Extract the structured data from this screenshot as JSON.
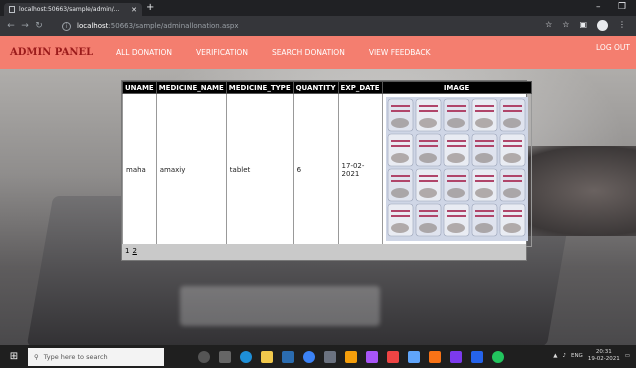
{
  "browser": {
    "tab_title": "localhost:50663/sample/admin/...",
    "new_tab": "+",
    "url_host": "localhost",
    "url_path": ":50663/sample/adminallonation.aspx",
    "minimize": "–",
    "restore": "❐",
    "close": "✕"
  },
  "nav": {
    "brand": "ADMIN PANEL",
    "links": [
      "ALL DONATION",
      "VERIFICATION",
      "SEARCH DONATION",
      "VIEW FEEDBACK"
    ],
    "logout": "LOG OUT"
  },
  "grid": {
    "headers": [
      "UNAME",
      "MEDICINE_NAME",
      "MEDICINE_TYPE",
      "QUANTITY",
      "EXP_DATE",
      "IMAGE"
    ],
    "rows": [
      {
        "uname": "maha",
        "medicine_name": "amaxiy",
        "medicine_type": "tablet",
        "quantity": "6",
        "exp_date": "17-02-2021"
      }
    ],
    "pager": [
      "1",
      "2"
    ]
  },
  "taskbar": {
    "search_placeholder": "Type here to search",
    "lang": "ENG",
    "time": "20:31",
    "date": "19-02-2021"
  }
}
